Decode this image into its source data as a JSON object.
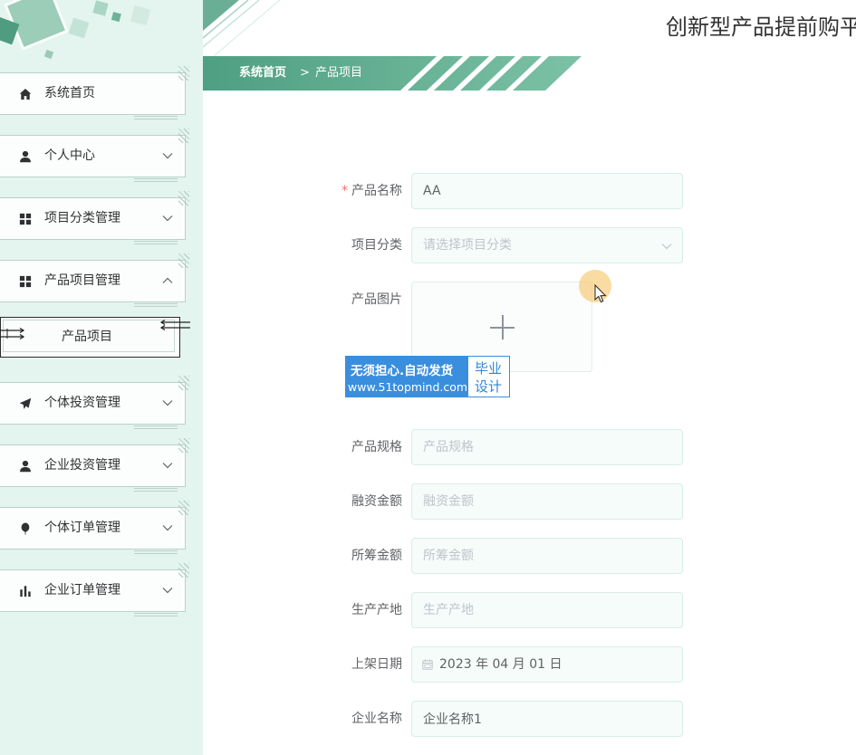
{
  "header": {
    "title": "创新型产品提前购平"
  },
  "breadcrumb": {
    "home": "系统首页",
    "separator": ">",
    "current": "产品项目"
  },
  "sidebar": {
    "items": [
      {
        "label": "系统首页",
        "icon": "home-icon"
      },
      {
        "label": "个人中心",
        "icon": "user-icon",
        "expanded": false
      },
      {
        "label": "项目分类管理",
        "icon": "grid-icon",
        "expanded": false
      },
      {
        "label": "产品项目管理",
        "icon": "grid-icon",
        "expanded": true,
        "children": [
          {
            "label": "产品项目",
            "active": true
          }
        ]
      },
      {
        "label": "个体投资管理",
        "icon": "paper-plane-icon",
        "expanded": false
      },
      {
        "label": "企业投资管理",
        "icon": "user-icon",
        "expanded": false
      },
      {
        "label": "个体订单管理",
        "icon": "balloon-icon",
        "expanded": false
      },
      {
        "label": "企业订单管理",
        "icon": "bar-chart-icon",
        "expanded": false
      }
    ]
  },
  "form": {
    "product_name": {
      "label": "产品名称",
      "required_mark": "*",
      "value": "AA"
    },
    "category": {
      "label": "项目分类",
      "placeholder": "请选择项目分类"
    },
    "image": {
      "label": "产品图片",
      "upload_icon": "plus-icon"
    },
    "spec": {
      "label": "产品规格",
      "placeholder": "产品规格"
    },
    "financing_amount": {
      "label": "融资金额",
      "placeholder": "融资金额"
    },
    "raised_amount": {
      "label": "所筹金额",
      "placeholder": "所筹金额"
    },
    "origin": {
      "label": "生产产地",
      "placeholder": "生产产地"
    },
    "listing_date": {
      "label": "上架日期",
      "value": "2023 年 04 月 01 日",
      "icon": "calendar-icon"
    },
    "company_name": {
      "label": "企业名称",
      "value": "企业名称1"
    }
  },
  "watermark": {
    "line1": "无须担心.自动发货",
    "line2": "www.51topmind.com",
    "badge_line1": "毕业",
    "badge_line2": "设计"
  },
  "colors": {
    "sidebar_bg": "#e4f4ee",
    "accent": "#5aa587",
    "required": "#f56c6c",
    "watermark_blue": "#3a8ede",
    "cursor_highlight": "#f7c86e"
  }
}
